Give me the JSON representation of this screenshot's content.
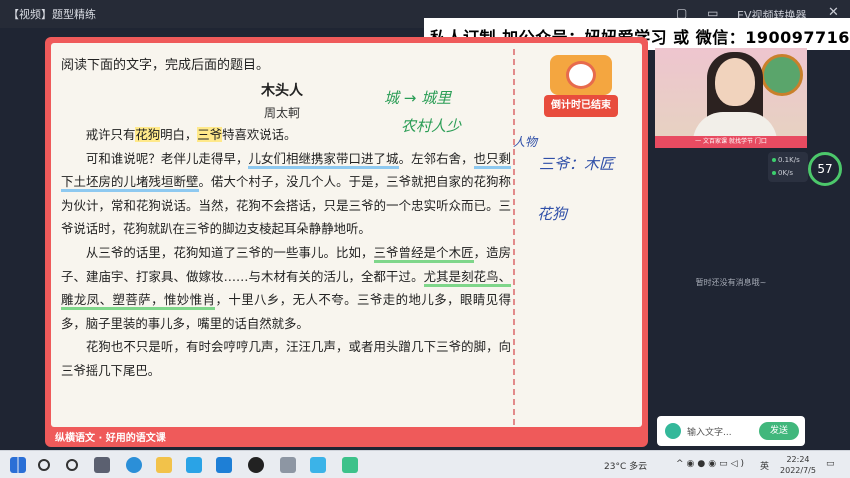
{
  "window": {
    "title": "【视频】题型精练",
    "right_label": "EV视频转换器"
  },
  "banner": {
    "text": "私人订制 加公众号：妞妞爱学习 或 微信：190097716"
  },
  "slide": {
    "instruction": "阅读下面的文字，完成后面的题目。",
    "passage_title": "木头人",
    "author": "周太軻",
    "paragraph1": {
      "a": "戒许只有",
      "hl1": "花狗",
      "b": "明白，",
      "hl2": "三爷",
      "c": "特喜欢说话。"
    },
    "paragraph2": {
      "a": "可和谁说呢？老伴儿走得早，",
      "ub1": "儿女们相继携家带口进了城",
      "b": "。左邻右舍，",
      "ub2": "也只剩下土坯房的儿堵残垣断壁",
      "c": "。偌大个村子，没几个人。于是，三爷就把自家的花狗称为伙计，常和花狗说话。当然，花狗不会搭话，只是三爷的一个忠实听众而已。三爷说话时，花狗就趴在三爷的脚边支棱起耳朵静静地听。"
    },
    "paragraph3": {
      "a": "从三爷的话里，花狗知道了三爷的一些事儿。比如，",
      "ug1": "三爷曾经是个木匠",
      "b": "，造房子、建庙宇、打家具、做嫁妆……与木材有关的活儿，全都干过。",
      "ug2": "尤其是刻花鸟、雕龙凤、塑菩萨，惟妙惟肖",
      "c": "，十里八乡，无人不夸。三爷走的地儿多，眼睛见得多，脑子里装的事儿多，嘴里的话自然就多。"
    },
    "paragraph4": "花狗也不只是听，有时会哼哼几声，汪汪几声，或者用头蹭几下三爷的脚，向三爷摇几下尾巴。",
    "footer": "纵横语文 · 好用的语文课",
    "timer_label": "倒计时已结束",
    "annotations": {
      "a1": "城 → 城里",
      "a2": "农村人少",
      "a3": "人物",
      "a4": "三爷：木匠",
      "a5": "花狗"
    }
  },
  "camera": {
    "caption": "一 文百家课 就找学节 门口"
  },
  "network": {
    "up": "0.1",
    "up_unit": "K/s",
    "down": "0",
    "down_unit": "K/s",
    "gauge": "57"
  },
  "chat": {
    "empty_text": "暂时还没有消息哦~",
    "placeholder": "输入文字...",
    "send_label": "发送"
  },
  "taskbar": {
    "weather": "23°C 多云",
    "ime": "英",
    "time": "22:24",
    "date": "2022/7/5"
  },
  "colors": {
    "accent_red": "#ef5a5a",
    "highlight_yellow": "#ffe98a",
    "underline_blue": "#8ec9f0",
    "underline_green": "#7fd68a"
  }
}
